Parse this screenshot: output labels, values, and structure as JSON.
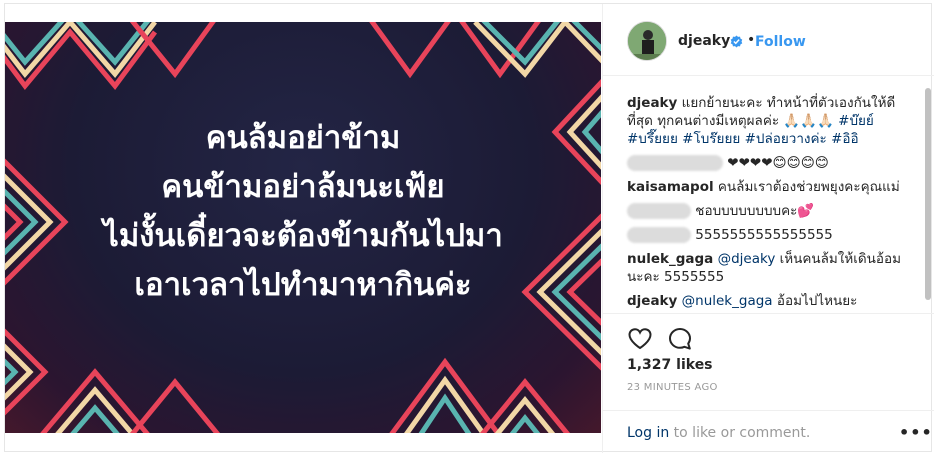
{
  "post": {
    "image_text": [
      "คนล้มอย่าข้าม",
      "คนข้ามอย่าล้มนะเฟ้ย",
      "ไม่งั้นเดี๋ยวจะต้องข้ามกันไปมา",
      "เอาเวลาไปทำมาหากินค่ะ"
    ]
  },
  "header": {
    "username": "djeaky",
    "separator": "•",
    "follow_label": "Follow",
    "verified_icon": "verified-badge-icon"
  },
  "caption": {
    "username": "djeaky",
    "text": "แยกย้ายนะคะ ทำหน้าที่ตัวเองกันให้ดีที่สุด ทุกคนต่างมีเหตุผลค่ะ 🙏🏻🙏🏻🙏🏻",
    "hashtags": [
      "#บ๊ยย์",
      "#บรึ๊ยยย",
      "#โบร๊ยยย",
      "#ปล่อยวางค่ะ",
      "#อิอิ"
    ]
  },
  "comments": [
    {
      "username": "",
      "text": "❤❤❤❤😊😊😊😊"
    },
    {
      "username": "kaisamapol",
      "text": "คนล้มเราต้องช่วยพยุงคะคุณแม่"
    },
    {
      "username": "",
      "text": "ชอบบบบบบบบคะ💕"
    },
    {
      "username": "",
      "text": "5555555555555555"
    },
    {
      "username": "nulek_gaga",
      "mention": "@djeaky",
      "text": "เห็นคนล้มให้เดินอ้อมนะคะ 5555555"
    },
    {
      "username": "djeaky",
      "mention": "@nulek_gaga",
      "text": "อ้อมไปไหนยะ"
    }
  ],
  "actions": {
    "like_icon": "heart-icon",
    "comment_icon": "comment-bubble-icon",
    "likes_label": "1,327 likes",
    "timestamp": "23 MINUTES AGO"
  },
  "footer": {
    "login_link": "Log in",
    "login_suffix": " to like or comment.",
    "more_label": "•••"
  },
  "colors": {
    "link_blue": "#3897f0",
    "hashtag_blue": "#003569",
    "image_bg": "#1c1b35",
    "zigzag_red": "#e8445a",
    "zigzag_cream": "#f2d7a6",
    "zigzag_teal": "#59b4b0"
  }
}
